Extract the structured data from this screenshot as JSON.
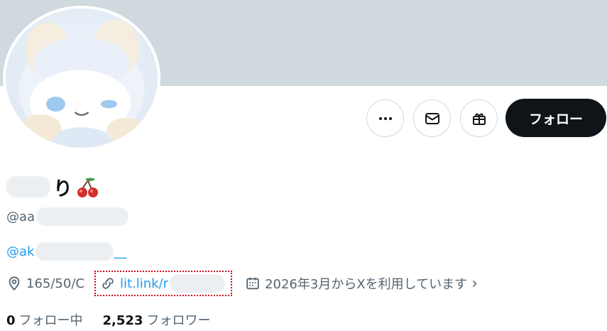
{
  "header": {
    "follow_label": "フォロー",
    "more_icon": "more-icon",
    "mail_icon": "mail-icon",
    "gift_icon": "gift-icon"
  },
  "profile": {
    "display_name_suffix": "り",
    "handle_prefix": "@aa",
    "bio_link_prefix": "@ak",
    "bio_link_suffix": "__",
    "location": "165/50/C",
    "website": "lit.link/r",
    "joined": "2026年3月からXを利用しています",
    "following_count": "0",
    "following_label": "フォロー中",
    "followers_count": "2,523",
    "followers_label": "フォロワー"
  },
  "colors": {
    "banner": "#cfd9de",
    "link": "#1d9bf0",
    "primary_button": "#0f1419",
    "muted_text": "#536471"
  }
}
